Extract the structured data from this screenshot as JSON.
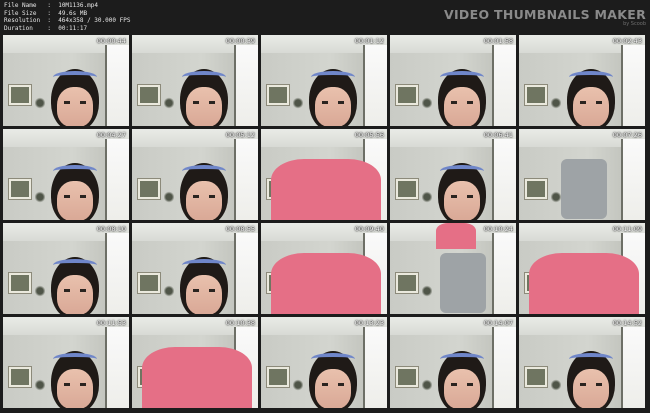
{
  "meta": {
    "file_name_label": "File Name",
    "file_name": "10M1136.mp4",
    "file_size_label": "File Size",
    "file_size": "49.6s MB",
    "resolution_label": "Resolution",
    "resolution": "464x358 / 30.000 FPS",
    "duration_label": "Duration",
    "duration": "00:11:17"
  },
  "brand": {
    "title": "VIDEO THUMBNAILS MAKER",
    "sub": "by Scoob"
  },
  "thumbnails": [
    {
      "ts": "00:00:44",
      "variant": "face"
    },
    {
      "ts": "00:00:39",
      "variant": "face"
    },
    {
      "ts": "00:01:12",
      "variant": "face"
    },
    {
      "ts": "00:01:58",
      "variant": "face"
    },
    {
      "ts": "00:02:43",
      "variant": "face"
    },
    {
      "ts": "00:04:27",
      "variant": "face"
    },
    {
      "ts": "00:05:12",
      "variant": "face"
    },
    {
      "ts": "00:05:56",
      "variant": "lean-pink"
    },
    {
      "ts": "00:06:41",
      "variant": "face"
    },
    {
      "ts": "00:07:26",
      "variant": "shorts"
    },
    {
      "ts": "00:08:10",
      "variant": "face"
    },
    {
      "ts": "00:08:55",
      "variant": "face"
    },
    {
      "ts": "00:09:40",
      "variant": "lean-pink"
    },
    {
      "ts": "00:10:24",
      "variant": "lean-grey"
    },
    {
      "ts": "00:11:09",
      "variant": "lean-pink"
    },
    {
      "ts": "00:11:53",
      "variant": "face"
    },
    {
      "ts": "00:10:38",
      "variant": "lean-pink"
    },
    {
      "ts": "00:13:23",
      "variant": "face"
    },
    {
      "ts": "00:14:07",
      "variant": "face"
    },
    {
      "ts": "00:14:52",
      "variant": "face"
    }
  ]
}
